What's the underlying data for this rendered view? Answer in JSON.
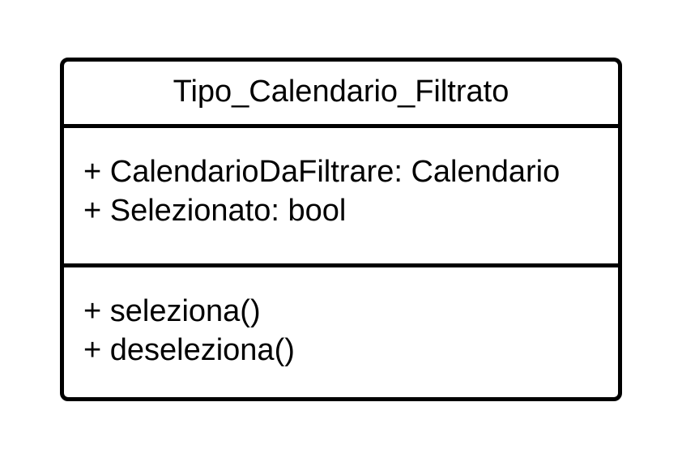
{
  "uml_class": {
    "name": "Tipo_Calendario_Filtrato",
    "attributes": [
      "+ CalendarioDaFiltrare: Calendario",
      "+ Selezionato: bool"
    ],
    "methods": [
      "+ seleziona()",
      "+ deseleziona()"
    ]
  }
}
